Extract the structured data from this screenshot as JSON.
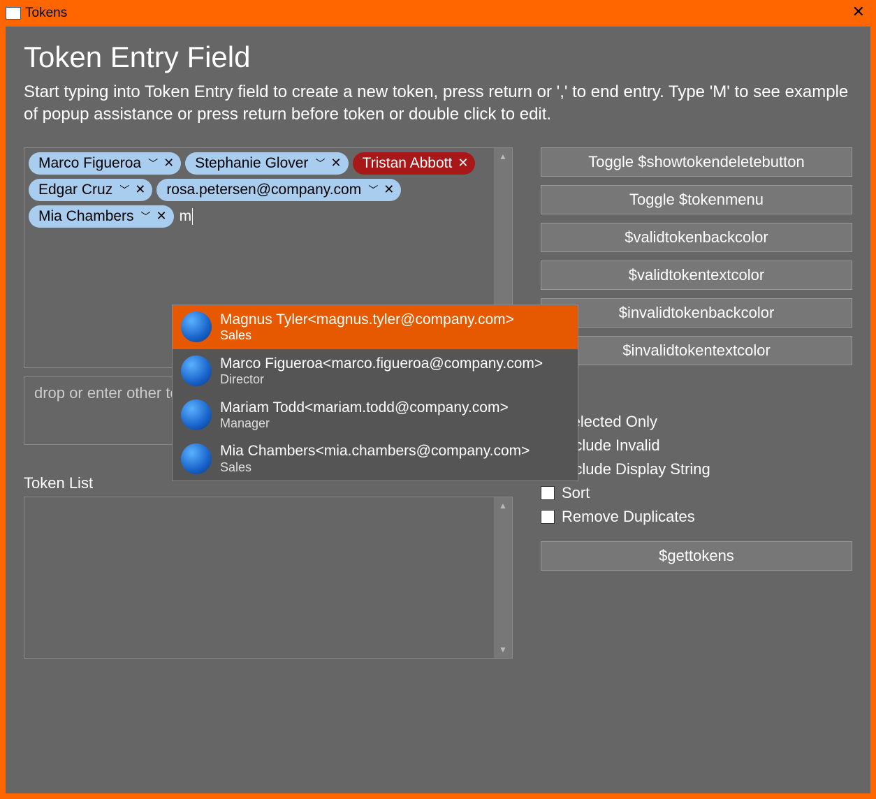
{
  "window": {
    "title": "Tokens"
  },
  "heading": "Token Entry Field",
  "description": "Start typing into Token Entry field to create a new token, press return or ',' to end entry.  Type 'M' to see example of popup assistance or press return before token or double click to edit.",
  "tokens": [
    {
      "label": "Marco Figueroa",
      "valid": true,
      "menu": true,
      "delete": true
    },
    {
      "label": "Stephanie Glover",
      "valid": true,
      "menu": true,
      "delete": true
    },
    {
      "label": "Tristan Abbott",
      "valid": false,
      "menu": false,
      "delete": true
    },
    {
      "label": "Edgar Cruz",
      "valid": true,
      "menu": true,
      "delete": true
    },
    {
      "label": "rosa.petersen@company.com",
      "valid": true,
      "menu": true,
      "delete": true
    },
    {
      "label": "Mia Chambers",
      "valid": true,
      "menu": true,
      "delete": true
    }
  ],
  "entry_text": "m",
  "dropbox_placeholder": "drop or enter other tokens here",
  "token_list_label": "Token List",
  "side_buttons": {
    "toggle_delete": "Toggle $showtokendeletebutton",
    "toggle_menu": "Toggle $tokenmenu",
    "valid_back": "$validtokenbackcolor",
    "valid_text": "$validtokentextcolor",
    "invalid_back": "$invalidtokenbackcolor",
    "invalid_text": "$invalidtokentextcolor"
  },
  "options": {
    "selected_only": {
      "label": "Selected Only",
      "checked": false
    },
    "include_invalid": {
      "label": "Include Invalid",
      "checked": true
    },
    "include_display": {
      "label": "Include Display String",
      "checked": false
    },
    "sort": {
      "label": "Sort",
      "checked": false
    },
    "remove_dupes": {
      "label": "Remove Duplicates",
      "checked": false
    }
  },
  "gettokens_label": "$gettokens",
  "popup": [
    {
      "name": "Magnus Tyler<magnus.tyler@company.com>",
      "role": "Sales",
      "selected": true
    },
    {
      "name": "Marco Figueroa<marco.figueroa@company.com>",
      "role": "Director",
      "selected": false
    },
    {
      "name": "Mariam Todd<mariam.todd@company.com>",
      "role": "Manager",
      "selected": false
    },
    {
      "name": "Mia Chambers<mia.chambers@company.com>",
      "role": "Sales",
      "selected": false
    }
  ]
}
